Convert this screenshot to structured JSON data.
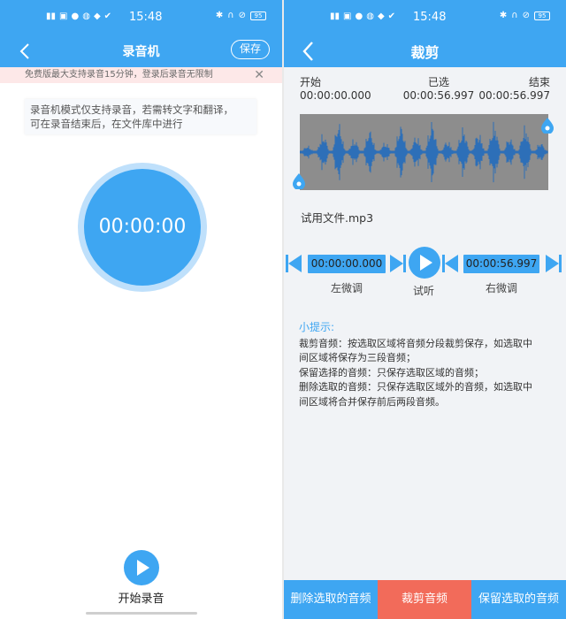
{
  "status_bar": {
    "time": "15:48",
    "battery": "95"
  },
  "recorder": {
    "title": "录音机",
    "save_label": "保存",
    "notice": "免费版最大支持录音15分钟，登录后录音无限制",
    "hint_line1": "录音机模式仅支持录音，若需转文字和翻译，",
    "hint_line2": "可在录音结束后，在文件库中进行",
    "timer": "00:00:00",
    "start_label": "开始录音"
  },
  "trim": {
    "title": "裁剪",
    "start_label": "开始",
    "start_time": "00:00:00.000",
    "selected_label": "已选",
    "selected_time": "00:00:56.997",
    "end_label": "结束",
    "end_time": "00:00:56.997",
    "file_name": "试用文件.mp3",
    "left_box_time": "00:00:00.000",
    "right_box_time": "00:00:56.997",
    "left_adjust_label": "左微调",
    "preview_label": "试听",
    "right_adjust_label": "右微调",
    "tips_title": "小提示:",
    "tips": [
      "裁剪音频：按选取区域将音频分段裁剪保存，如选取中",
      "间区域将保存为三段音频；",
      "保留选择的音频：只保存选取区域的音频；",
      "删除选取的音频：只保存选取区域外的音频，如选取中",
      "间区域将合并保存前后两段音频。"
    ],
    "buttons": {
      "delete": "删除选取的音频",
      "cut": "裁剪音频",
      "keep": "保留选取的音频"
    }
  },
  "colors": {
    "accent": "#3ea6f2",
    "danger": "#f26b5a",
    "waveform": "#2d6fb8",
    "waveform_bg": "#8d8d8d"
  }
}
